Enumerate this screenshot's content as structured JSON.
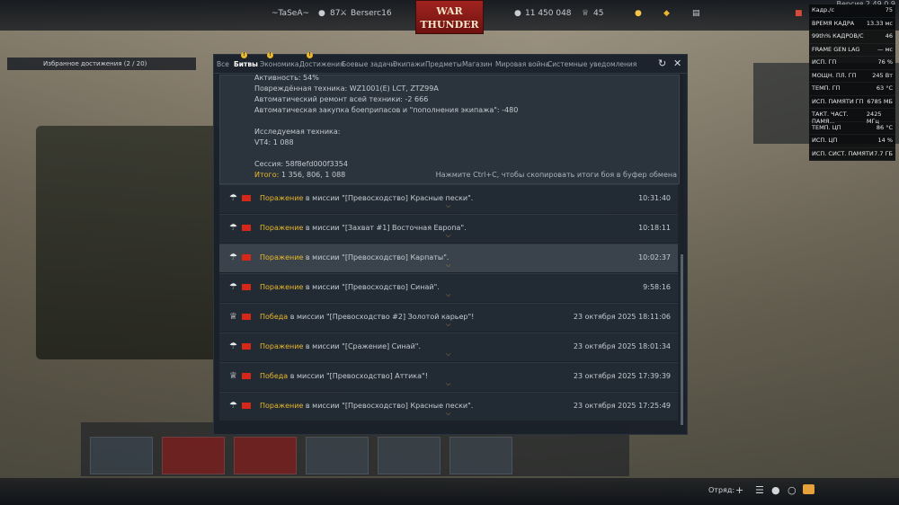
{
  "version": "Версия 2.49.0.9",
  "topbar": {
    "nick_left": "~TaSeA~",
    "squad_count": "87",
    "player": "Berserc16",
    "silver": "11 450 048",
    "gold": "45"
  },
  "logo": {
    "line1": "WAR",
    "line2": "THUNDER"
  },
  "fps_overlay": [
    {
      "k": "Кадр./с",
      "v": "75"
    },
    {
      "k": "ВРЕМЯ КАДРА",
      "v": "13.33 мс"
    },
    {
      "k": "99th% КАДРОВ/С",
      "v": "46"
    },
    {
      "k": "FRAME GEN LAG",
      "v": "— мс"
    },
    {
      "k": "ИСП. ГП",
      "v": "76 %"
    },
    {
      "k": "МОЩН. ПЛ. ГП",
      "v": "245 Вт"
    },
    {
      "k": "ТЕМП. ГП",
      "v": "63 °C"
    },
    {
      "k": "ИСП. ПАМЯТИ ГП",
      "v": "6785 МБ"
    },
    {
      "k": "ТАКТ. ЧАСТ. ПАМЯ...",
      "v": "2425 МГц"
    },
    {
      "k": "ТЕМП. ЦП",
      "v": "86 °C"
    },
    {
      "k": "ИСП. ЦП",
      "v": "14 %"
    },
    {
      "k": "ИСП. СИСТ. ПАМЯТИ",
      "v": "7.7 ГБ"
    }
  ],
  "left_panel_title": "Избранное достижения (2 / 20)",
  "tabs": [
    "Все",
    "Битвы",
    "Экономика",
    "Достижения",
    "Боевые задачи",
    "Экипажи",
    "Предметы",
    "Магазин",
    "Мировая война",
    "Системные уведомления"
  ],
  "summary": {
    "activity": "Активность: 54%",
    "damaged": "Повреждённая техника: WZ1001(E) LCT, ZTZ99A",
    "repair": "Автоматический ремонт всей техники: -2 666",
    "resupply": "Автоматическая закупка боеприпасов и \"пополнения экипажа\": -480",
    "research_title": "Исследуемая техника:",
    "research": "VT4: 1 088",
    "session": "Сессия: 58f8efd000f3354",
    "total_label": "Итого:",
    "total": "1 356, 806, 1 088",
    "hint": "Нажмите Ctrl+C, чтобы скопировать итоги боя в буфер обмена"
  },
  "battles": [
    {
      "result": "Поражение",
      "mid": " в миссии ",
      "mission": "\"[Превосходство] Красные пески\".",
      "time": "10:31:40",
      "icon": "parachute-icon",
      "highlight": false
    },
    {
      "result": "Поражение",
      "mid": " в миссии ",
      "mission": "\"[Захват #1] Восточная Европа\".",
      "time": "10:18:11",
      "icon": "parachute-icon",
      "highlight": false
    },
    {
      "result": "Поражение",
      "mid": " в миссии ",
      "mission": "\"[Превосходство] Карпаты\".",
      "time": "10:02:37",
      "icon": "parachute-icon",
      "highlight": true
    },
    {
      "result": "Поражение",
      "mid": " в миссии ",
      "mission": "\"[Превосходство] Синай\".",
      "time": "9:58:16",
      "icon": "parachute-icon",
      "highlight": false
    },
    {
      "result": "Победа",
      "mid": " в миссии ",
      "mission": "\"[Превосходство #2] Золотой карьер\"!",
      "time": "23 октября 2025 18:11:06",
      "icon": "trophy-icon",
      "highlight": false
    },
    {
      "result": "Поражение",
      "mid": " в миссии ",
      "mission": "\"[Сражение] Синай\".",
      "time": "23 октября 2025 18:01:34",
      "icon": "parachute-icon",
      "highlight": false
    },
    {
      "result": "Победа",
      "mid": " в миссии ",
      "mission": "\"[Превосходство] Аттика\"!",
      "time": "23 октября 2025 17:39:39",
      "icon": "trophy-icon",
      "highlight": false
    },
    {
      "result": "Поражение",
      "mid": " в миссии ",
      "mission": "\"[Превосходство] Красные пески\".",
      "time": "23 октября 2025 17:25:49",
      "icon": "parachute-icon",
      "highlight": false
    }
  ],
  "bottombar": {
    "squad_label": "Отряд:"
  },
  "colors": {
    "accent": "#e8b72c",
    "flag": "#d62718",
    "panel": "#1b2129"
  }
}
